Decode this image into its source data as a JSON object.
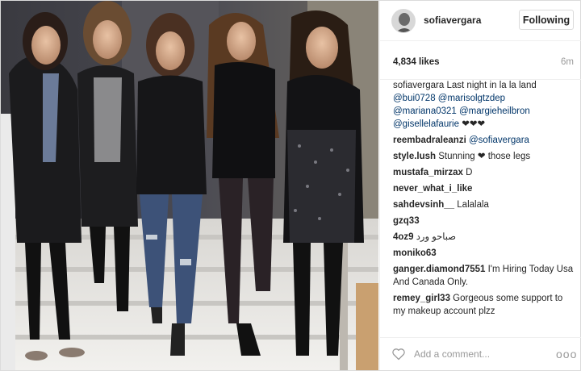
{
  "post": {
    "username": "sofiavergara",
    "follow_label": "Following",
    "likes": "4,834 likes",
    "time": "6m",
    "caption": {
      "user": "sofiavergara",
      "text": "Last night in la la land",
      "mentions_line1": "@bui0728 @marisolgtzdep",
      "mentions_line2": "@mariana0321 @margieheilbron",
      "mentions_line3": "@gisellelafaurie",
      "hearts": "❤❤❤"
    },
    "comments": [
      {
        "user": "reembadraleanzi",
        "text": "@sofiavergara"
      },
      {
        "user": "style.lush",
        "text": "Stunning ❤ those legs"
      },
      {
        "user": "mustafa_mirzax",
        "text": "D"
      },
      {
        "user": "never_what_i_like",
        "text": ""
      },
      {
        "user": "sahdevsinh__",
        "text": "Lalalala"
      },
      {
        "user": "gzq33",
        "text": ""
      },
      {
        "user": "4oz9",
        "text": "صباحو ورد"
      },
      {
        "user": "moniko63",
        "text": ""
      },
      {
        "user": "ganger.diamond7551",
        "text": "I'm Hiring Today Usa And Canada Only."
      },
      {
        "user": "remey_girl33",
        "text": "Gorgeous some support to my makeup account plzz"
      }
    ],
    "add_comment_placeholder": "Add a comment...",
    "more_label": "ooo"
  },
  "colors": {
    "mention": "#003569",
    "text": "#262626",
    "muted": "#999999",
    "border": "#efefef"
  },
  "icons": {
    "like": "heart-outline-icon",
    "more": "more-options-icon"
  }
}
